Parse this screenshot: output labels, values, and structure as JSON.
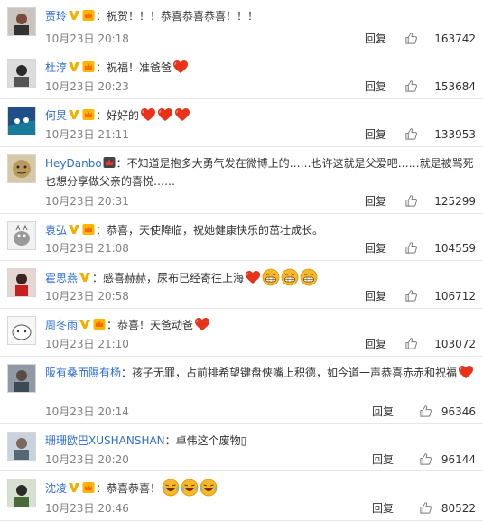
{
  "comments": [
    {
      "name": "贾玲",
      "badges": [
        "v",
        "vip"
      ],
      "text": "：祝贺！！！恭喜恭喜恭喜！！！",
      "tail": [],
      "time": "10月23日 20:18",
      "reply": "回复",
      "likes": "163742"
    },
    {
      "name": "杜淳",
      "badges": [
        "v",
        "vip"
      ],
      "text": "：祝福！准爸爸",
      "tail": [
        "heart"
      ],
      "time": "10月23日 20:23",
      "reply": "回复",
      "likes": "153684"
    },
    {
      "name": "何炅",
      "badges": [
        "v",
        "vip"
      ],
      "text": "：好好的",
      "tail": [
        "heart",
        "heart",
        "heart"
      ],
      "time": "10月23日 21:11",
      "reply": "回复",
      "likes": "133953"
    },
    {
      "name": "HeyDanbo",
      "badges": [
        "vip-dark"
      ],
      "text": "：不知道是抱多大勇气发在微博上的……也许这就是父爱吧……就是被骂死也想分享做父亲的喜悦……",
      "tail": [],
      "time": "10月23日 20:31",
      "reply": "回复",
      "likes": "125299"
    },
    {
      "name": "袁弘",
      "badges": [
        "v",
        "vip"
      ],
      "text": "：恭喜，天使降临，祝她健康快乐的茁壮成长。",
      "tail": [],
      "time": "10月23日 21:08",
      "reply": "回复",
      "likes": "104559"
    },
    {
      "name": "霍思燕",
      "badges": [
        "v"
      ],
      "text": "：感喜赫赫，尿布已经寄往上海",
      "tail": [
        "heart",
        "grin",
        "grin",
        "grin"
      ],
      "time": "10月23日 20:58",
      "reply": "回复",
      "likes": "106712"
    },
    {
      "name": "周冬雨",
      "badges": [
        "v",
        "vip"
      ],
      "text": "：恭喜！天爸动爸",
      "tail": [
        "heart"
      ],
      "time": "10月23日 21:10",
      "reply": "回复",
      "likes": "103072"
    },
    {
      "name": "阪有桑而隰有杨",
      "badges": [],
      "text": "：孩子无罪，占前排希望键盘侠嘴上积德，如今道一声恭喜赤赤和祝福",
      "tail": [
        "heart"
      ],
      "time": "10月23日 20:14",
      "reply": "回复",
      "likes": "96346"
    },
    {
      "name": "珊珊欧巴XUSHANSHAN",
      "badges": [],
      "text": "：卓伟这个废物▯",
      "tail": [],
      "time": "10月23日 20:20",
      "reply": "回复",
      "likes": "96144"
    },
    {
      "name": "沈凌",
      "badges": [
        "v",
        "vip"
      ],
      "text": "：恭喜恭喜！",
      "tail": [
        "tear",
        "tear",
        "tear"
      ],
      "time": "10月23日 20:46",
      "reply": "回复",
      "likes": "80522"
    }
  ],
  "colors": {
    "name": "#2f6ed3",
    "text": "#333333",
    "meta": "#808080",
    "heart": "#e8321a",
    "emoji": "#f7b928",
    "divider": "#e8e8e8"
  },
  "icons": {
    "like": "thumbs-up-icon",
    "v": "v-verified-icon",
    "vip": "vip-crown-icon",
    "heart": "heart-emoji",
    "grin": "grin-emoji",
    "tear": "laugh-cry-emoji"
  }
}
